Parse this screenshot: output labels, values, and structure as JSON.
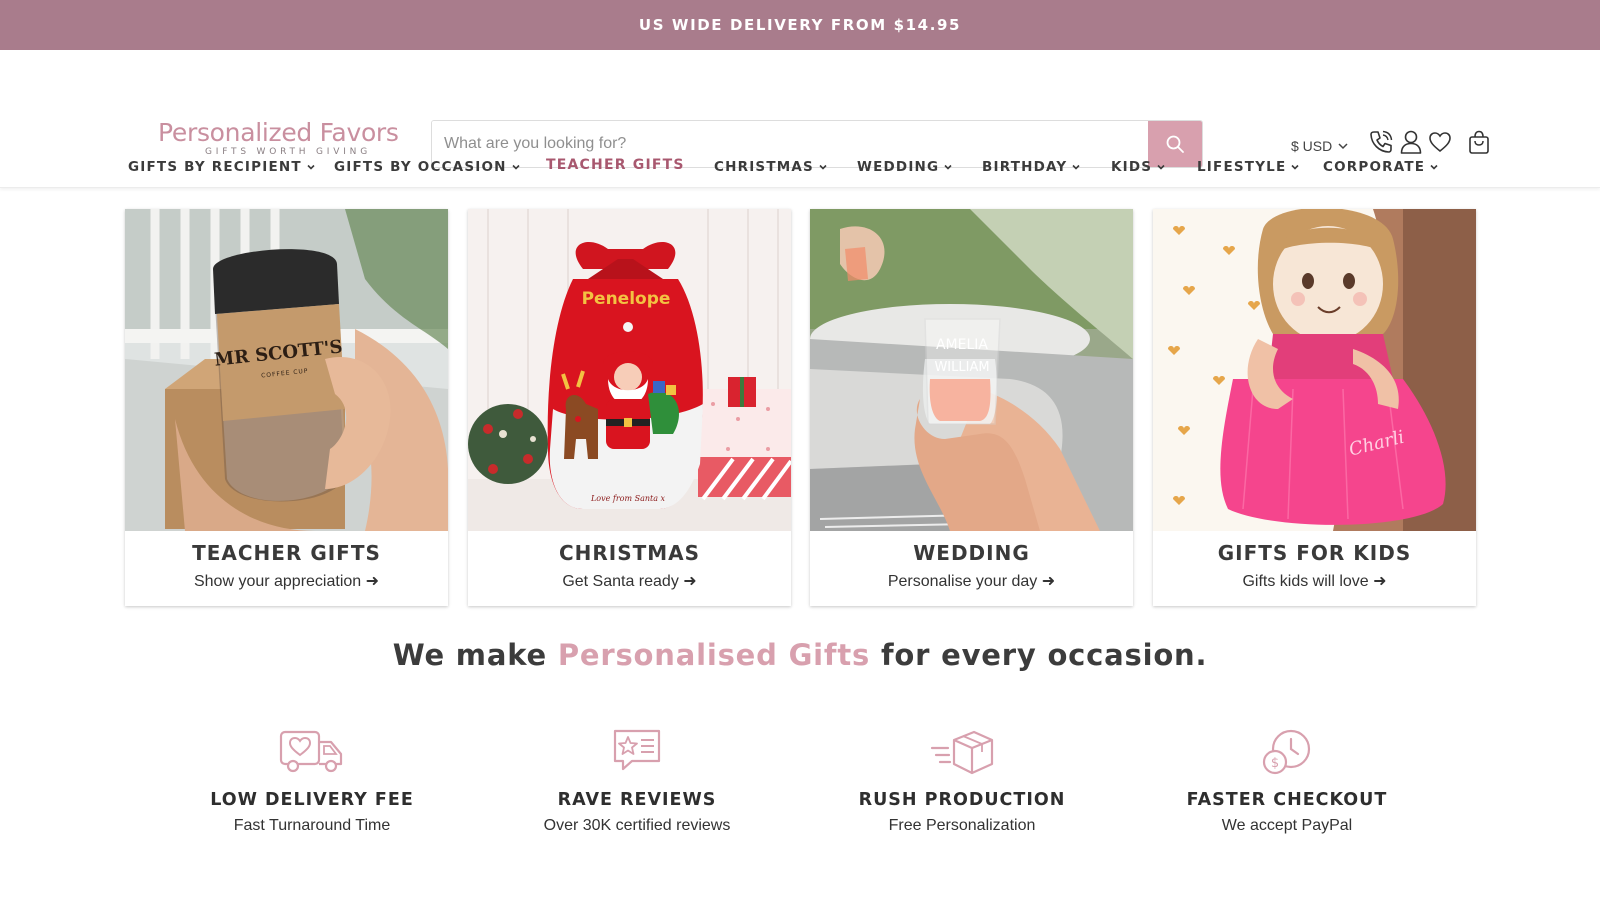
{
  "announcement": {
    "text": "US WIDE DELIVERY FROM $14.95"
  },
  "header": {
    "logo_main": "Personalized Favors",
    "logo_tagline": "GIFTS WORTH GIVING",
    "search_placeholder": "What are you looking for?",
    "currency": "$ USD",
    "icons": [
      "phone-icon",
      "account-icon",
      "wishlist-heart-icon",
      "cart-bag-icon"
    ]
  },
  "nav": {
    "items": [
      {
        "label": "GIFTS BY RECIPIENT",
        "has_dropdown": true
      },
      {
        "label": "GIFTS BY OCCASION",
        "has_dropdown": true
      },
      {
        "label": "TEACHER GIFTS",
        "has_dropdown": false,
        "highlighted": true
      },
      {
        "label": "CHRISTMAS",
        "has_dropdown": true
      },
      {
        "label": "WEDDING",
        "has_dropdown": true
      },
      {
        "label": "BIRTHDAY",
        "has_dropdown": true
      },
      {
        "label": "KIDS",
        "has_dropdown": true
      },
      {
        "label": "LIFESTYLE",
        "has_dropdown": true
      },
      {
        "label": "CORPORATE",
        "has_dropdown": true
      }
    ]
  },
  "cards": [
    {
      "title": "TEACHER GIFTS",
      "subtitle": "Show your appreciation ➜",
      "image_text": "MR SCOTT'S",
      "image_subtext": "COFFEE CUP"
    },
    {
      "title": "CHRISTMAS",
      "subtitle": "Get Santa ready ➜",
      "image_text": "Penelope",
      "image_subtext": "Love from Santa x"
    },
    {
      "title": "WEDDING",
      "subtitle": "Personalise your day ➜",
      "image_text": "AMELIA",
      "image_subtext": "WILLIAM"
    },
    {
      "title": "GIFTS FOR KIDS",
      "subtitle": "Gifts kids will love ➜",
      "image_text": "Charli"
    }
  ],
  "tagline": {
    "before": "We make ",
    "highlight": "Personalised Gifts",
    "after": " for every occasion."
  },
  "features": [
    {
      "icon": "delivery-truck-icon",
      "title": "LOW DELIVERY FEE",
      "subtitle": "Fast Turnaround Time"
    },
    {
      "icon": "review-star-icon",
      "title": "RAVE REVIEWS",
      "subtitle": "Over 30K certified reviews"
    },
    {
      "icon": "fast-box-icon",
      "title": "RUSH PRODUCTION",
      "subtitle": "Free Personalization"
    },
    {
      "icon": "clock-dollar-icon",
      "title": "FASTER CHECKOUT",
      "subtitle": "We accept PayPal"
    }
  ],
  "colors": {
    "announcement_bg": "#a97c8c",
    "accent_pink": "#d8a0ae",
    "nav_highlight": "#a8586f",
    "logo_pink": "#c98f9f"
  }
}
